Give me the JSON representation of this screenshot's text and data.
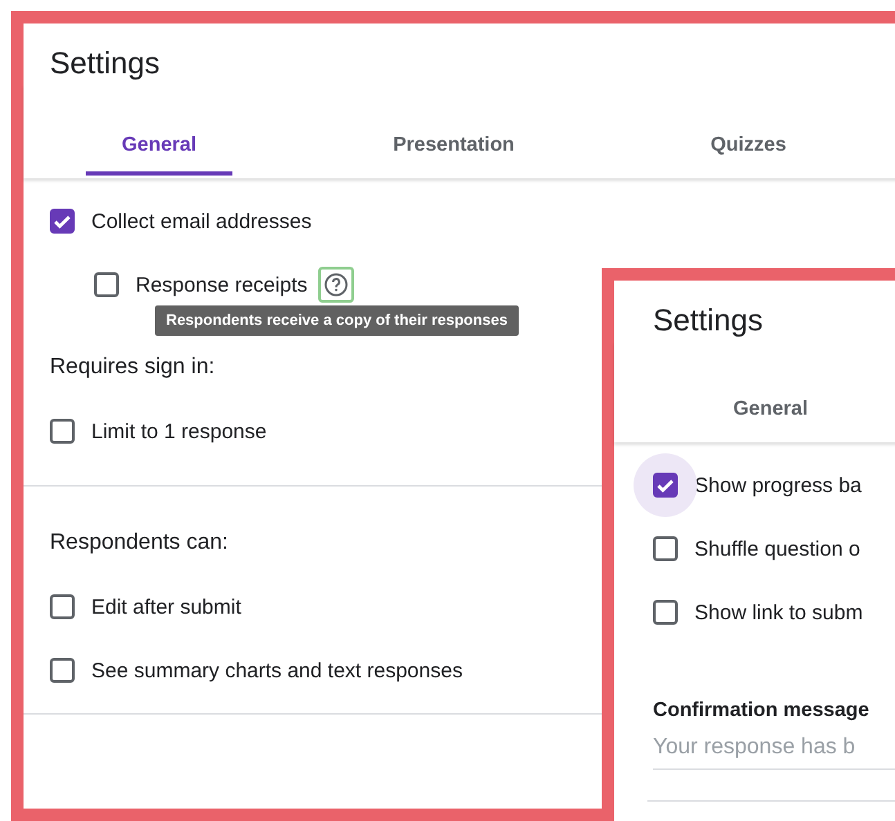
{
  "panels": [
    {
      "title": "Settings",
      "tabs": [
        {
          "label": "General",
          "selected": true
        },
        {
          "label": "Presentation",
          "selected": false
        },
        {
          "label": "Quizzes",
          "selected": false
        }
      ],
      "sections": [
        {
          "items": [
            {
              "kind": "checkbox",
              "label": "Collect email addresses",
              "checked": true,
              "children": [
                {
                  "kind": "checkbox",
                  "label": "Response receipts",
                  "checked": false,
                  "help": {
                    "tooltip": "Respondents receive a copy of their responses"
                  }
                }
              ]
            },
            {
              "kind": "heading",
              "label": "Requires sign in:"
            },
            {
              "kind": "checkbox",
              "label": "Limit to 1 response",
              "checked": false
            }
          ]
        },
        {
          "items": [
            {
              "kind": "heading",
              "label": "Respondents can:"
            },
            {
              "kind": "checkbox",
              "label": "Edit after submit",
              "checked": false
            },
            {
              "kind": "checkbox",
              "label": "See summary charts and text responses",
              "checked": false
            }
          ]
        }
      ]
    },
    {
      "title": "Settings",
      "tabs": [
        {
          "label": "General",
          "selected": false
        }
      ],
      "sections": [
        {
          "items": [
            {
              "kind": "checkbox",
              "label": "Show progress ba",
              "checked": true,
              "focused": true
            },
            {
              "kind": "checkbox",
              "label": "Shuffle question o",
              "checked": false
            },
            {
              "kind": "checkbox",
              "label": "Show link to subm",
              "checked": false
            },
            {
              "kind": "field_label",
              "label": "Confirmation message"
            },
            {
              "kind": "field",
              "placeholder": "Your response has b"
            }
          ]
        }
      ]
    }
  ]
}
